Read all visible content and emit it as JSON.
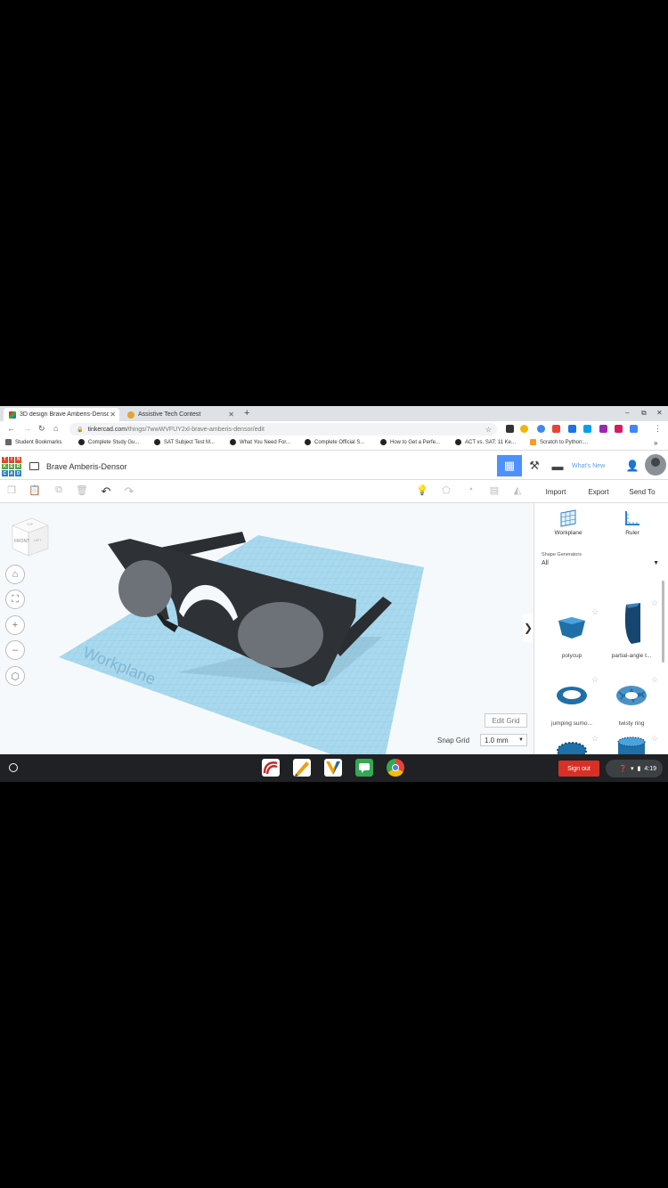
{
  "browser": {
    "tabs": [
      {
        "title": "3D design Brave Amberis-Densor",
        "active": true
      },
      {
        "title": "Assistive Tech Contest",
        "active": false
      }
    ],
    "url_host": "tinkercad.com",
    "url_path": "/things/7wwWVFUY2xl-brave-amberis-densor/edit",
    "bookmarks": [
      "Student Bookmarks",
      "Complete Study Gu...",
      "SAT Subject Test M...",
      "What You Need For...",
      "Complete Official S...",
      "How to Get a Perfe...",
      "ACT vs. SAT: 11 Ke...",
      "Scratch to Python:..."
    ],
    "more_bookmarks": "»"
  },
  "app": {
    "logo_letters": [
      "T",
      "I",
      "N",
      "K",
      "E",
      "R",
      "C",
      "A",
      "D"
    ],
    "design_title": "Brave Amberis-Densor",
    "whats_new": "What's New"
  },
  "toolbar": {
    "import": "Import",
    "export": "Export",
    "send_to": "Send To"
  },
  "viewport": {
    "workplane_label": "Workplane",
    "viewcube_front": "FRONT",
    "viewcube_top": "TOP",
    "viewcube_right": "LEFT",
    "edit_grid": "Edit Grid",
    "snap_grid_label": "Snap Grid",
    "snap_grid_value": "1.0 mm"
  },
  "panel": {
    "workplane": "Workplane",
    "ruler": "Ruler",
    "generators_label": "Shape Generators",
    "generators_value": "All",
    "shapes": [
      {
        "label": "polycup",
        "icon": "polycup-icon"
      },
      {
        "label": "partial-angle t...",
        "icon": "partial-angle-icon"
      },
      {
        "label": "jumping sumo...",
        "icon": "torus-ring-icon"
      },
      {
        "label": "twisty ring",
        "icon": "twisty-ring-icon"
      }
    ]
  },
  "shelf": {
    "sign_out": "Sign out",
    "time": "4:19"
  },
  "colors": {
    "accent": "#4d90fe",
    "workplane": "#9fd3ec",
    "shape_blue": "#1f6fa8",
    "sign_out": "#d93025"
  }
}
